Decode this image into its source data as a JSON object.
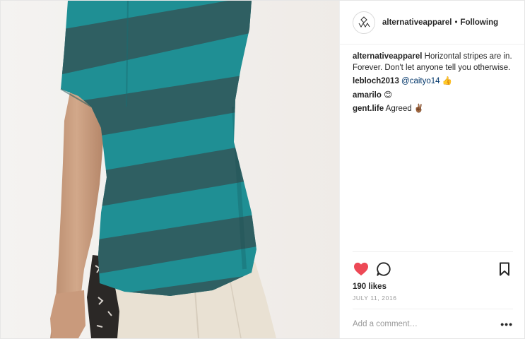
{
  "post": {
    "header": {
      "username": "alternativeapparel",
      "separator": "•",
      "follow_status": "Following",
      "avatar_icon": "alternative-apparel-logo-icon"
    },
    "caption": {
      "username": "alternativeapparel",
      "text": "Horizontal stripes are in. Forever. Don't let anyone tell you otherwise."
    },
    "comments": [
      {
        "username": "lebloch2013",
        "mention": "@caityo14",
        "text": "👍"
      },
      {
        "username": "amarilo",
        "text": "😊"
      },
      {
        "username": "gent.life",
        "text": "Agreed ✌🏾"
      }
    ],
    "actions": {
      "like_icon": "heart-filled-icon",
      "comment_icon": "comment-bubble-icon",
      "save_icon": "bookmark-icon",
      "liked": true
    },
    "likes_text": "190 likes",
    "date": "JULY 11, 2016",
    "add_comment_placeholder": "Add a comment…",
    "more_options": "•••",
    "colors": {
      "heart": "#ed4956",
      "text": "#262626",
      "muted": "#999999",
      "shirt_light": "#1f8f94",
      "shirt_dark": "#2f5f62"
    }
  }
}
